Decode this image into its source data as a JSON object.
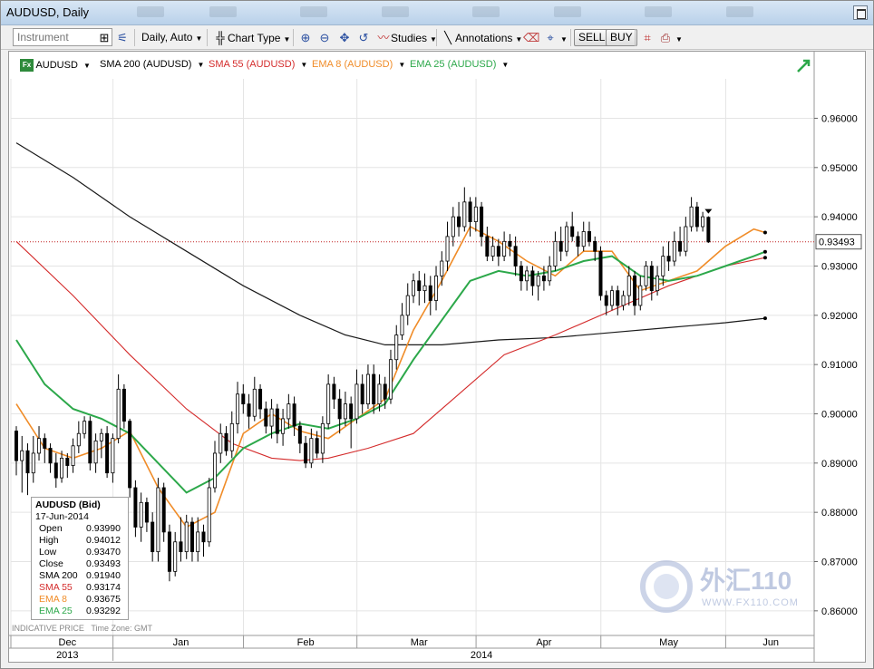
{
  "window": {
    "title": "AUDUSD, Daily"
  },
  "toolbar": {
    "instrument_placeholder": "Instrument",
    "interval": "Daily,",
    "interval_mode": "Auto",
    "chart_type": "Chart Type",
    "studies": "Studies",
    "annotations": "Annotations",
    "sell": "SELL",
    "buy": "BUY"
  },
  "legend": {
    "instrument": "AUDUSD",
    "sma200": "SMA 200 (AUDUSD)",
    "sma55": "SMA 55 (AUDUSD)",
    "ema8": "EMA 8 (AUDUSD)",
    "ema25": "EMA 25 (AUDUSD)"
  },
  "colors": {
    "sma200": "#1a1a1a",
    "sma55": "#d42b2b",
    "ema8": "#f08c28",
    "ema25": "#2ca84a",
    "candle_up": "#ffffff",
    "candle_down": "#000000",
    "price_line": "#c02020"
  },
  "info_box": {
    "title": "AUDUSD (Bid)",
    "date": "17-Jun-2014",
    "rows": [
      {
        "label": "Open",
        "value": "0.93990",
        "color": "#000000"
      },
      {
        "label": "High",
        "value": "0.94012",
        "color": "#000000"
      },
      {
        "label": "Low",
        "value": "0.93470",
        "color": "#000000"
      },
      {
        "label": "Close",
        "value": "0.93493",
        "color": "#000000"
      },
      {
        "label": "SMA 200",
        "value": "0.91940",
        "color": "#000000"
      },
      {
        "label": "SMA 55",
        "value": "0.93174",
        "color": "#d42b2b"
      },
      {
        "label": "EMA 8",
        "value": "0.93675",
        "color": "#f08c28"
      },
      {
        "label": "EMA 25",
        "value": "0.93292",
        "color": "#2ca84a"
      }
    ]
  },
  "footer": {
    "indicative": "INDICATIVE PRICE",
    "timezone": "Time Zone: GMT"
  },
  "watermark": {
    "text": "外汇110",
    "url": "WWW.FX110.COM"
  },
  "chart_data": {
    "type": "candlestick",
    "title": "AUDUSD, Daily",
    "ylim": [
      0.855,
      0.968
    ],
    "y_ticks": [
      "0.96000",
      "0.95000",
      "0.94000",
      "0.93000",
      "0.92000",
      "0.91000",
      "0.90000",
      "0.89000",
      "0.88000",
      "0.87000",
      "0.86000"
    ],
    "last_price": "0.93493",
    "x_months": [
      "Dec",
      "Jan",
      "Feb",
      "Mar",
      "Apr",
      "May",
      "Jun"
    ],
    "x_years": [
      "2013",
      "2014"
    ],
    "x_range_days": [
      0,
      140
    ],
    "month_starts": [
      0,
      18,
      41,
      61,
      82,
      104,
      126
    ],
    "month_label_pos": [
      9,
      29,
      51,
      71,
      93,
      115,
      133
    ],
    "year_label": [
      {
        "label": "2013",
        "at": 9
      },
      {
        "label": "2014",
        "at": 82
      }
    ],
    "legend": [
      "AUDUSD",
      "SMA 200 (AUDUSD)",
      "SMA 55 (AUDUSD)",
      "EMA 8 (AUDUSD)",
      "EMA 25 (AUDUSD)"
    ],
    "candles": [
      [
        0.8965,
        0.8905,
        0.8975,
        0.8875
      ],
      [
        0.8905,
        0.8925,
        0.8955,
        0.884
      ],
      [
        0.8925,
        0.888,
        0.894,
        0.8835
      ],
      [
        0.888,
        0.892,
        0.8955,
        0.886
      ],
      [
        0.892,
        0.895,
        0.8975,
        0.8905
      ],
      [
        0.895,
        0.893,
        0.896,
        0.89
      ],
      [
        0.893,
        0.89,
        0.894,
        0.888
      ],
      [
        0.89,
        0.887,
        0.892,
        0.885
      ],
      [
        0.887,
        0.891,
        0.8925,
        0.886
      ],
      [
        0.891,
        0.8895,
        0.892,
        0.887
      ],
      [
        0.8895,
        0.8935,
        0.895,
        0.888
      ],
      [
        0.8935,
        0.896,
        0.8985,
        0.892
      ],
      [
        0.896,
        0.8985,
        0.8995,
        0.895
      ],
      [
        0.8985,
        0.89,
        0.8995,
        0.8885
      ],
      [
        0.89,
        0.8945,
        0.896,
        0.888
      ],
      [
        0.8945,
        0.896,
        0.897,
        0.891
      ],
      [
        0.896,
        0.888,
        0.8975,
        0.887
      ],
      [
        0.888,
        0.895,
        0.896,
        0.886
      ],
      [
        0.895,
        0.905,
        0.908,
        0.894
      ],
      [
        0.905,
        0.8985,
        0.906,
        0.897
      ],
      [
        0.8985,
        0.885,
        0.899,
        0.883
      ],
      [
        0.885,
        0.877,
        0.8865,
        0.875
      ],
      [
        0.877,
        0.882,
        0.884,
        0.874
      ],
      [
        0.882,
        0.878,
        0.883,
        0.876
      ],
      [
        0.878,
        0.872,
        0.88,
        0.87
      ],
      [
        0.872,
        0.885,
        0.887,
        0.87
      ],
      [
        0.885,
        0.876,
        0.886,
        0.874
      ],
      [
        0.876,
        0.868,
        0.8775,
        0.866
      ],
      [
        0.868,
        0.874,
        0.876,
        0.867
      ],
      [
        0.874,
        0.872,
        0.879,
        0.87
      ],
      [
        0.872,
        0.878,
        0.8795,
        0.8705
      ],
      [
        0.878,
        0.872,
        0.879,
        0.87
      ],
      [
        0.872,
        0.876,
        0.879,
        0.87
      ],
      [
        0.876,
        0.874,
        0.8775,
        0.871
      ],
      [
        0.874,
        0.885,
        0.887,
        0.873
      ],
      [
        0.885,
        0.892,
        0.8945,
        0.884
      ],
      [
        0.892,
        0.896,
        0.898,
        0.89
      ],
      [
        0.896,
        0.8925,
        0.8975,
        0.8915
      ],
      [
        0.8925,
        0.898,
        0.9005,
        0.891
      ],
      [
        0.898,
        0.904,
        0.9065,
        0.896
      ],
      [
        0.904,
        0.902,
        0.906,
        0.9
      ],
      [
        0.902,
        0.8995,
        0.904,
        0.897
      ],
      [
        0.8995,
        0.905,
        0.9075,
        0.8985
      ],
      [
        0.905,
        0.901,
        0.906,
        0.899
      ],
      [
        0.901,
        0.8975,
        0.9025,
        0.896
      ],
      [
        0.8975,
        0.901,
        0.903,
        0.895
      ],
      [
        0.901,
        0.896,
        0.902,
        0.894
      ],
      [
        0.896,
        0.899,
        0.901,
        0.8935
      ],
      [
        0.899,
        0.902,
        0.904,
        0.897
      ],
      [
        0.902,
        0.8975,
        0.9035,
        0.8955
      ],
      [
        0.8975,
        0.894,
        0.8985,
        0.892
      ],
      [
        0.894,
        0.89,
        0.8955,
        0.889
      ],
      [
        0.89,
        0.895,
        0.897,
        0.889
      ],
      [
        0.895,
        0.892,
        0.8965,
        0.891
      ],
      [
        0.892,
        0.898,
        0.8995,
        0.89
      ],
      [
        0.898,
        0.906,
        0.908,
        0.897
      ],
      [
        0.906,
        0.903,
        0.9075,
        0.901
      ],
      [
        0.903,
        0.899,
        0.905,
        0.896
      ],
      [
        0.899,
        0.902,
        0.9045,
        0.8975
      ],
      [
        0.902,
        0.899,
        0.9035,
        0.893
      ],
      [
        0.899,
        0.906,
        0.909,
        0.898
      ],
      [
        0.906,
        0.902,
        0.908,
        0.9
      ],
      [
        0.902,
        0.908,
        0.91,
        0.901
      ],
      [
        0.908,
        0.902,
        0.91,
        0.9
      ],
      [
        0.902,
        0.906,
        0.908,
        0.9005
      ],
      [
        0.906,
        0.903,
        0.9075,
        0.901
      ],
      [
        0.903,
        0.911,
        0.913,
        0.902
      ],
      [
        0.911,
        0.916,
        0.918,
        0.909
      ],
      [
        0.916,
        0.92,
        0.9225,
        0.915
      ],
      [
        0.92,
        0.924,
        0.9265,
        0.918
      ],
      [
        0.924,
        0.927,
        0.9285,
        0.9225
      ],
      [
        0.927,
        0.925,
        0.929,
        0.922
      ],
      [
        0.925,
        0.926,
        0.9285,
        0.9225
      ],
      [
        0.926,
        0.923,
        0.928,
        0.92
      ],
      [
        0.923,
        0.928,
        0.93,
        0.921
      ],
      [
        0.928,
        0.931,
        0.933,
        0.926
      ],
      [
        0.931,
        0.936,
        0.939,
        0.929
      ],
      [
        0.936,
        0.94,
        0.942,
        0.934
      ],
      [
        0.94,
        0.938,
        0.943,
        0.936
      ],
      [
        0.938,
        0.943,
        0.946,
        0.937
      ],
      [
        0.943,
        0.939,
        0.944,
        0.936
      ],
      [
        0.939,
        0.942,
        0.944,
        0.937
      ],
      [
        0.942,
        0.936,
        0.943,
        0.934
      ],
      [
        0.936,
        0.932,
        0.938,
        0.931
      ],
      [
        0.932,
        0.934,
        0.936,
        0.931
      ],
      [
        0.934,
        0.932,
        0.9355,
        0.93
      ],
      [
        0.932,
        0.935,
        0.937,
        0.931
      ],
      [
        0.935,
        0.934,
        0.9365,
        0.932
      ],
      [
        0.934,
        0.93,
        0.936,
        0.928
      ],
      [
        0.93,
        0.927,
        0.931,
        0.925
      ],
      [
        0.927,
        0.929,
        0.93,
        0.925
      ],
      [
        0.929,
        0.926,
        0.93,
        0.924
      ],
      [
        0.926,
        0.928,
        0.929,
        0.923
      ],
      [
        0.928,
        0.927,
        0.93,
        0.925
      ],
      [
        0.927,
        0.93,
        0.932,
        0.926
      ],
      [
        0.93,
        0.935,
        0.937,
        0.929
      ],
      [
        0.935,
        0.933,
        0.938,
        0.931
      ],
      [
        0.933,
        0.938,
        0.939,
        0.932
      ],
      [
        0.938,
        0.936,
        0.941,
        0.935
      ],
      [
        0.936,
        0.934,
        0.937,
        0.932
      ],
      [
        0.934,
        0.937,
        0.939,
        0.933
      ],
      [
        0.937,
        0.935,
        0.939,
        0.934
      ],
      [
        0.935,
        0.933,
        0.936,
        0.931
      ],
      [
        0.933,
        0.924,
        0.934,
        0.923
      ],
      [
        0.924,
        0.922,
        0.925,
        0.92
      ],
      [
        0.922,
        0.925,
        0.926,
        0.921
      ],
      [
        0.925,
        0.922,
        0.926,
        0.92
      ],
      [
        0.922,
        0.924,
        0.925,
        0.921
      ],
      [
        0.924,
        0.928,
        0.93,
        0.922
      ],
      [
        0.928,
        0.922,
        0.929,
        0.92
      ],
      [
        0.922,
        0.926,
        0.928,
        0.921
      ],
      [
        0.926,
        0.93,
        0.931,
        0.925
      ],
      [
        0.93,
        0.925,
        0.931,
        0.923
      ],
      [
        0.925,
        0.928,
        0.93,
        0.924
      ],
      [
        0.928,
        0.932,
        0.934,
        0.926
      ],
      [
        0.932,
        0.931,
        0.935,
        0.929
      ],
      [
        0.931,
        0.935,
        0.937,
        0.93
      ],
      [
        0.935,
        0.933,
        0.938,
        0.932
      ],
      [
        0.933,
        0.938,
        0.94,
        0.932
      ],
      [
        0.938,
        0.942,
        0.944,
        0.937
      ],
      [
        0.942,
        0.938,
        0.943,
        0.937
      ],
      [
        0.938,
        0.94,
        0.941,
        0.937
      ],
      [
        0.9399,
        0.9349,
        0.9401,
        0.9347
      ]
    ],
    "series": [
      {
        "name": "SMA 200 (AUDUSD)",
        "values": [
          [
            0,
            0.955
          ],
          [
            10,
            0.948
          ],
          [
            20,
            0.94
          ],
          [
            30,
            0.933
          ],
          [
            40,
            0.926
          ],
          [
            50,
            0.92
          ],
          [
            58,
            0.916
          ],
          [
            65,
            0.914
          ],
          [
            75,
            0.914
          ],
          [
            85,
            0.915
          ],
          [
            95,
            0.9155
          ],
          [
            105,
            0.9165
          ],
          [
            115,
            0.9175
          ],
          [
            125,
            0.9185
          ],
          [
            132,
            0.9194
          ]
        ]
      },
      {
        "name": "SMA 55 (AUDUSD)",
        "values": [
          [
            0,
            0.935
          ],
          [
            10,
            0.924
          ],
          [
            20,
            0.912
          ],
          [
            30,
            0.901
          ],
          [
            38,
            0.894
          ],
          [
            45,
            0.891
          ],
          [
            50,
            0.8905
          ],
          [
            55,
            0.891
          ],
          [
            62,
            0.893
          ],
          [
            70,
            0.896
          ],
          [
            78,
            0.904
          ],
          [
            86,
            0.912
          ],
          [
            95,
            0.916
          ],
          [
            105,
            0.921
          ],
          [
            115,
            0.926
          ],
          [
            125,
            0.93
          ],
          [
            132,
            0.9317
          ]
        ]
      },
      {
        "name": "EMA 8 (AUDUSD)",
        "values": [
          [
            0,
            0.902
          ],
          [
            5,
            0.893
          ],
          [
            10,
            0.891
          ],
          [
            15,
            0.893
          ],
          [
            20,
            0.8965
          ],
          [
            25,
            0.885
          ],
          [
            30,
            0.877
          ],
          [
            35,
            0.88
          ],
          [
            40,
            0.896
          ],
          [
            45,
            0.9
          ],
          [
            50,
            0.8965
          ],
          [
            55,
            0.895
          ],
          [
            60,
            0.899
          ],
          [
            65,
            0.903
          ],
          [
            70,
            0.917
          ],
          [
            75,
            0.927
          ],
          [
            80,
            0.938
          ],
          [
            85,
            0.935
          ],
          [
            90,
            0.931
          ],
          [
            95,
            0.928
          ],
          [
            100,
            0.933
          ],
          [
            105,
            0.933
          ],
          [
            110,
            0.925
          ],
          [
            115,
            0.927
          ],
          [
            120,
            0.929
          ],
          [
            125,
            0.934
          ],
          [
            130,
            0.9375
          ],
          [
            132,
            0.9368
          ]
        ]
      },
      {
        "name": "EMA 25 (AUDUSD)",
        "values": [
          [
            0,
            0.915
          ],
          [
            5,
            0.906
          ],
          [
            10,
            0.901
          ],
          [
            15,
            0.899
          ],
          [
            20,
            0.896
          ],
          [
            25,
            0.89
          ],
          [
            30,
            0.884
          ],
          [
            35,
            0.887
          ],
          [
            40,
            0.893
          ],
          [
            45,
            0.896
          ],
          [
            50,
            0.898
          ],
          [
            55,
            0.897
          ],
          [
            60,
            0.899
          ],
          [
            65,
            0.902
          ],
          [
            70,
            0.911
          ],
          [
            75,
            0.919
          ],
          [
            80,
            0.927
          ],
          [
            85,
            0.929
          ],
          [
            90,
            0.928
          ],
          [
            95,
            0.929
          ],
          [
            100,
            0.931
          ],
          [
            105,
            0.932
          ],
          [
            110,
            0.928
          ],
          [
            115,
            0.927
          ],
          [
            120,
            0.928
          ],
          [
            125,
            0.93
          ],
          [
            130,
            0.932
          ],
          [
            132,
            0.9329
          ]
        ]
      }
    ]
  }
}
